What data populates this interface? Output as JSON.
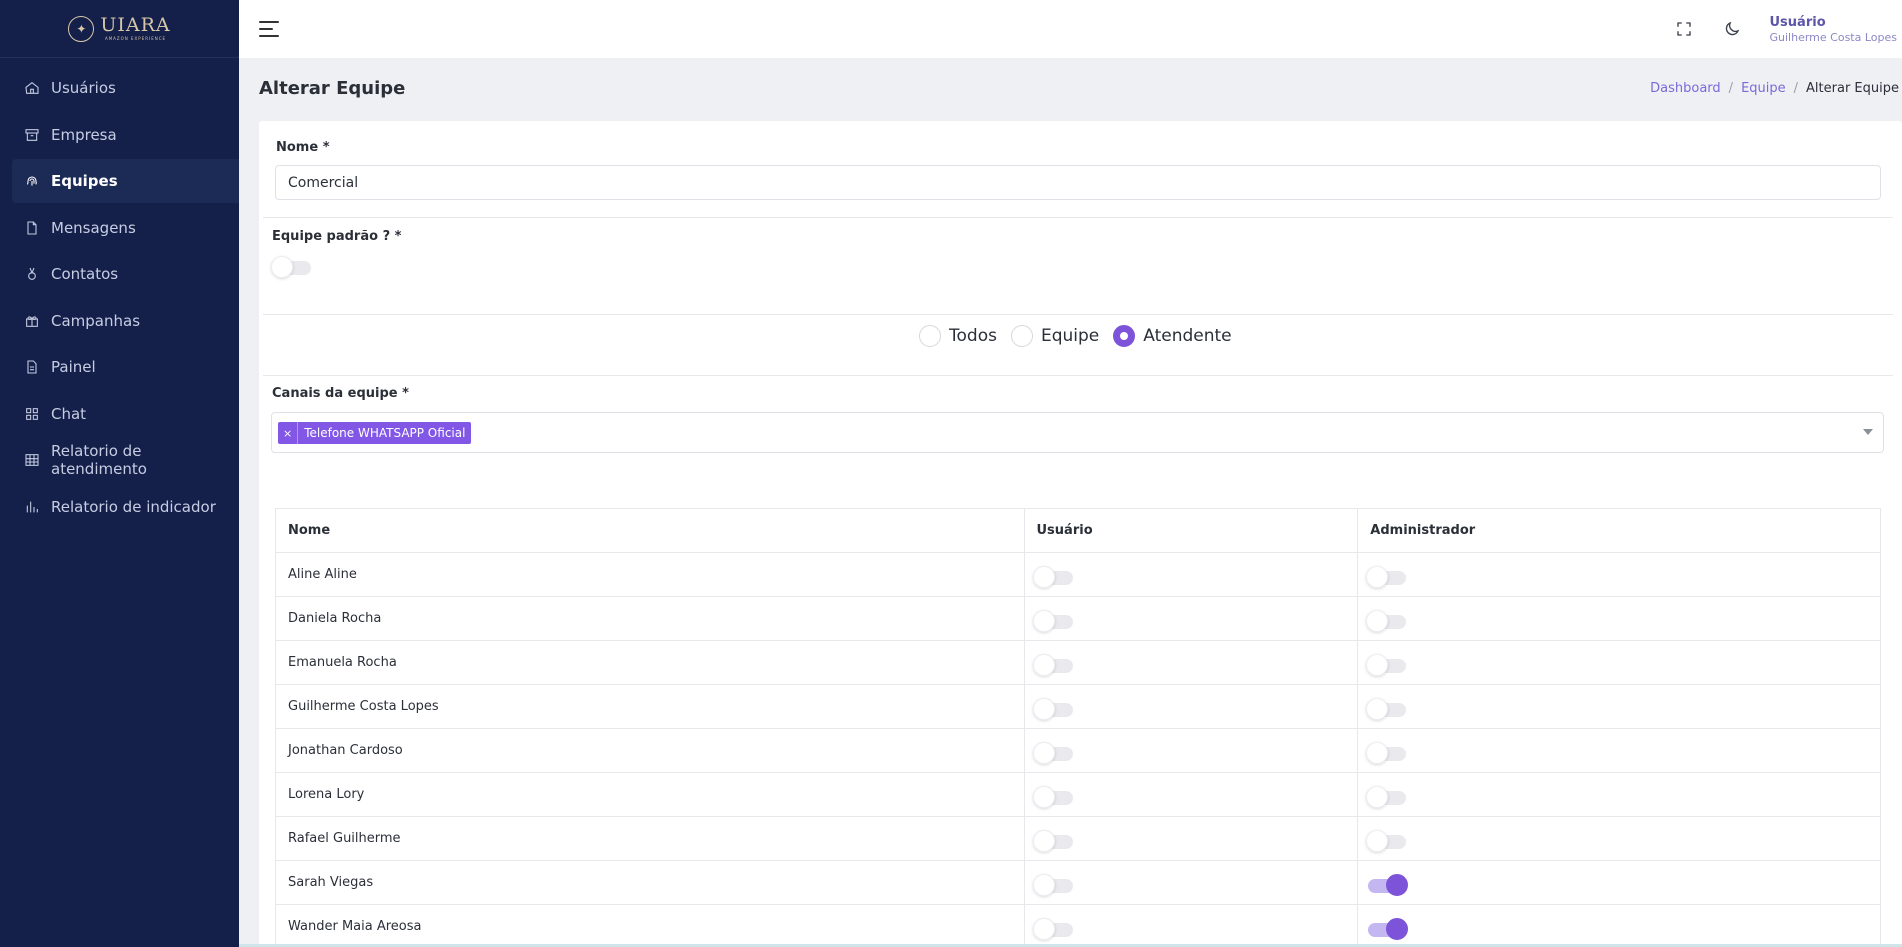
{
  "brand": {
    "name": "UIARA",
    "tagline": "AMAZON EXPERIENCE"
  },
  "sidebar": {
    "items": [
      {
        "label": "Usuários",
        "icon": "home-icon",
        "active": false
      },
      {
        "label": "Empresa",
        "icon": "archive-icon",
        "active": false
      },
      {
        "label": "Equipes",
        "icon": "fingerprint-icon",
        "active": true
      },
      {
        "label": "Mensagens",
        "icon": "file-icon",
        "active": false
      },
      {
        "label": "Contatos",
        "icon": "medal-icon",
        "active": false
      },
      {
        "label": "Campanhas",
        "icon": "gift-icon",
        "active": false
      },
      {
        "label": "Painel",
        "icon": "document-icon",
        "active": false
      },
      {
        "label": "Chat",
        "icon": "grid-icon",
        "active": false
      },
      {
        "label": "Relatorio de atendimento",
        "icon": "table-icon",
        "active": false
      },
      {
        "label": "Relatorio de indicador",
        "icon": "bar-chart-icon",
        "active": false
      }
    ]
  },
  "topbar": {
    "user_role": "Usuário",
    "user_name": "Guilherme Costa Lopes"
  },
  "page": {
    "title": "Alterar Equipe",
    "breadcrumb": [
      "Dashboard",
      "Equipe",
      "Alterar Equipe"
    ]
  },
  "form": {
    "name_label": "Nome *",
    "name_value": "Comercial",
    "default_team_label": "Equipe padrão ? *",
    "default_team_on": false,
    "radio_options": [
      {
        "label": "Todos",
        "checked": false
      },
      {
        "label": "Equipe",
        "checked": false
      },
      {
        "label": "Atendente",
        "checked": true
      }
    ],
    "channels_label": "Canais da equipe *",
    "channels_selected": [
      "Telefone WHATSAPP Oficial"
    ],
    "chip_remove": "×"
  },
  "table": {
    "headers": [
      "Nome",
      "Usuário",
      "Administrador"
    ],
    "rows": [
      {
        "name": "Aline Aline",
        "usuario": false,
        "admin": false
      },
      {
        "name": "Daniela Rocha",
        "usuario": false,
        "admin": false
      },
      {
        "name": "Emanuela Rocha",
        "usuario": false,
        "admin": false
      },
      {
        "name": "Guilherme Costa Lopes",
        "usuario": false,
        "admin": false
      },
      {
        "name": "Jonathan Cardoso",
        "usuario": false,
        "admin": false
      },
      {
        "name": "Lorena Lory",
        "usuario": false,
        "admin": false
      },
      {
        "name": "Rafael Guilherme",
        "usuario": false,
        "admin": false
      },
      {
        "name": "Sarah Viegas",
        "usuario": false,
        "admin": true
      },
      {
        "name": "Wander Maia Areosa",
        "usuario": false,
        "admin": true
      }
    ]
  },
  "colors": {
    "sidebar_bg": "#14204a",
    "accent": "#7d54d9",
    "chip_bg": "#8257e5",
    "link": "#7a6ad8"
  }
}
